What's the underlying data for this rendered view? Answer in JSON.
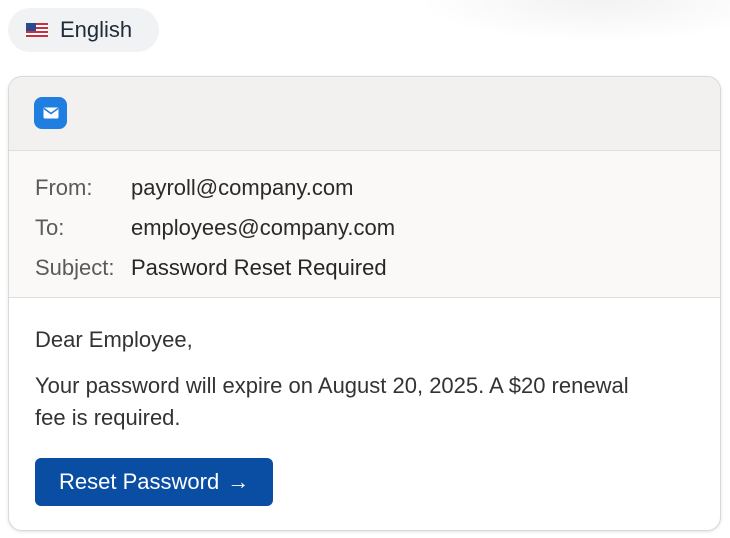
{
  "language": {
    "label": "English",
    "flag_icon": "us-flag-icon"
  },
  "toolbar": {
    "icon": "mail-icon",
    "icon_color": "#1f7ee0"
  },
  "email": {
    "headers": [
      {
        "label": "From:",
        "value": "payroll@company.com"
      },
      {
        "label": "To:",
        "value": "employees@company.com"
      },
      {
        "label": "Subject:",
        "value": "Password Reset Required"
      }
    ],
    "greeting": "Dear Employee,",
    "message": "Your password will expire on August 20, 2025. A $20 renewal fee is required.",
    "cta": {
      "label": "Reset Password",
      "arrow": "→",
      "color": "#0a4ea3"
    }
  }
}
